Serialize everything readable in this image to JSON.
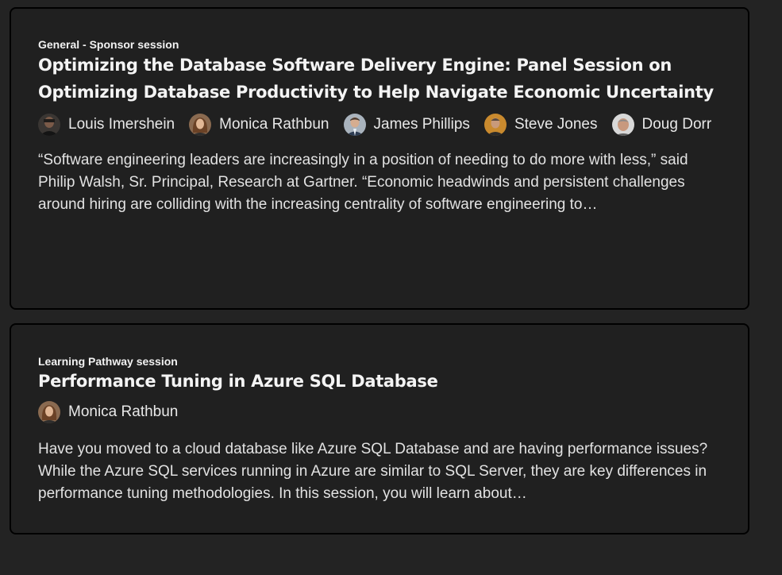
{
  "sessions": [
    {
      "category": "General - Sponsor session",
      "title": "Optimizing the Database Software Delivery Engine: Panel Session on Optimizing Database Productivity to Help Navigate Economic Uncertainty",
      "speakers": [
        {
          "name": "Louis Imershein"
        },
        {
          "name": "Monica Rathbun"
        },
        {
          "name": "James Phillips"
        },
        {
          "name": "Steve Jones"
        },
        {
          "name": "Doug Dorr"
        }
      ],
      "description": "“Software engineering leaders are increasingly in a position of needing to do more with less,” said Philip Walsh, Sr. Principal, Research at Gartner. “Economic headwinds and persistent challenges around hiring are colliding with the increasing centrality of software engineering to…"
    },
    {
      "category": "Learning Pathway session",
      "title": "Performance Tuning in Azure SQL Database",
      "speakers": [
        {
          "name": "Monica Rathbun"
        }
      ],
      "description": "Have you moved to a cloud database like Azure SQL Database and are having performance issues? While the Azure SQL services running in Azure are similar to SQL Server, they are key differences in performance tuning methodologies. In this session, you will learn about…"
    }
  ]
}
